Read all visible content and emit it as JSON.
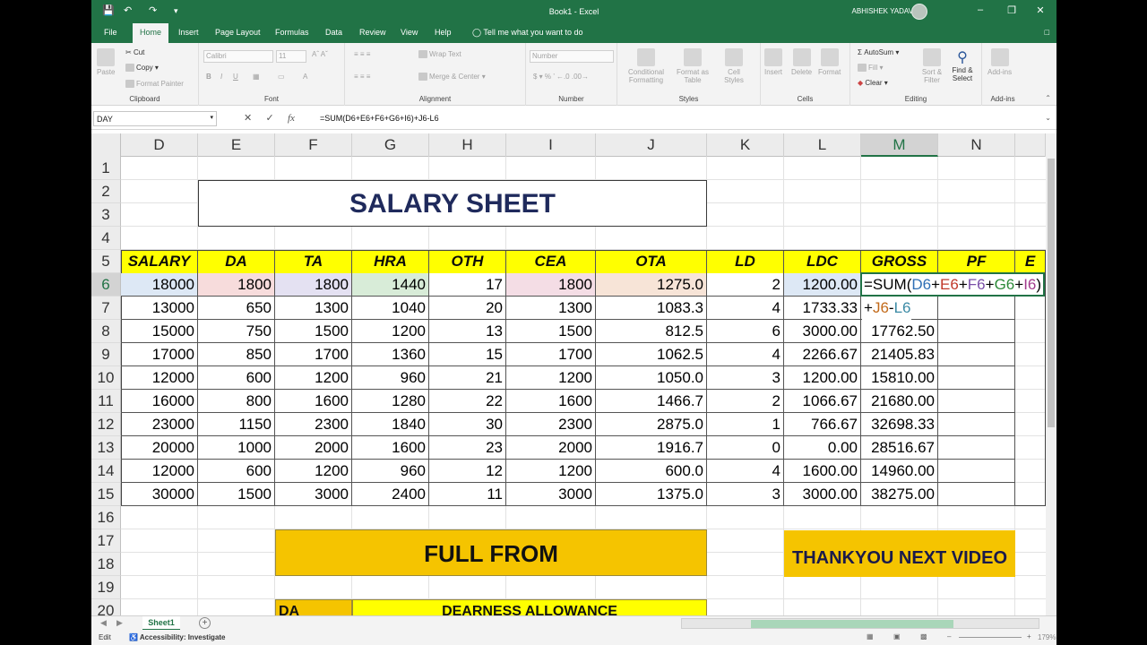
{
  "window": {
    "title": "Book1 - Excel",
    "user": "ABHISHEK YADAV"
  },
  "quick_access": {
    "save_icon": "save-icon",
    "undo_icon": "undo-icon",
    "redo_icon": "redo-icon"
  },
  "tabs": [
    "File",
    "Home",
    "Insert",
    "Page Layout",
    "Formulas",
    "Data",
    "Review",
    "View",
    "Help"
  ],
  "active_tab": "Home",
  "tell_me": "Tell me what you want to do",
  "ribbon": {
    "clipboard": {
      "label": "Clipboard",
      "paste": "Paste",
      "cut": "Cut",
      "copy": "Copy",
      "format_painter": "Format Painter"
    },
    "font": {
      "label": "Font",
      "name": "Calibri",
      "size": "11"
    },
    "alignment": {
      "label": "Alignment",
      "wrap": "Wrap Text",
      "merge": "Merge & Center"
    },
    "number": {
      "label": "Number",
      "format": "Number"
    },
    "styles": {
      "label": "Styles",
      "conditional": "Conditional Formatting",
      "format_table": "Format as Table",
      "cell_styles": "Cell Styles"
    },
    "cells": {
      "label": "Cells",
      "insert": "Insert",
      "delete": "Delete",
      "format": "Format"
    },
    "editing": {
      "label": "Editing",
      "autosum": "AutoSum",
      "fill": "Fill",
      "clear": "Clear",
      "sort": "Sort & Filter",
      "find": "Find & Select"
    },
    "addins": {
      "label": "Add-ins",
      "addins": "Add-ins"
    }
  },
  "formula_bar": {
    "name_box": "DAY",
    "formula": "=SUM(D6+E6+F6+G6+I6)+J6-L6",
    "fx": "fx"
  },
  "columns": [
    "D",
    "E",
    "F",
    "G",
    "H",
    "I",
    "J",
    "K",
    "L",
    "M",
    "N"
  ],
  "rows": [
    "1",
    "2",
    "3",
    "4",
    "5",
    "6",
    "7",
    "8",
    "9",
    "10",
    "11",
    "12",
    "13",
    "14",
    "15",
    "16",
    "17",
    "18",
    "19",
    "20"
  ],
  "title": "SALARY SHEET",
  "headers": [
    "SALARY",
    "DA",
    "TA",
    "HRA",
    "OTH",
    "CEA",
    "OTA",
    "LD",
    "LDC",
    "GROSS",
    "PF",
    "E"
  ],
  "table": [
    [
      "18000",
      "1800",
      "1800",
      "1440",
      "17",
      "1800",
      "1275.0",
      "2",
      "1200.00"
    ],
    [
      "13000",
      "650",
      "1300",
      "1040",
      "20",
      "1300",
      "1083.3",
      "4",
      "1733.33"
    ],
    [
      "15000",
      "750",
      "1500",
      "1200",
      "13",
      "1500",
      "812.5",
      "6",
      "3000.00"
    ],
    [
      "17000",
      "850",
      "1700",
      "1360",
      "15",
      "1700",
      "1062.5",
      "4",
      "2266.67"
    ],
    [
      "12000",
      "600",
      "1200",
      "960",
      "21",
      "1200",
      "1050.0",
      "3",
      "1200.00"
    ],
    [
      "16000",
      "800",
      "1600",
      "1280",
      "22",
      "1600",
      "1466.7",
      "2",
      "1066.67"
    ],
    [
      "23000",
      "1150",
      "2300",
      "1840",
      "30",
      "2300",
      "2875.0",
      "1",
      "766.67"
    ],
    [
      "20000",
      "1000",
      "2000",
      "1600",
      "23",
      "2000",
      "1916.7",
      "0",
      "0.00"
    ],
    [
      "12000",
      "600",
      "1200",
      "960",
      "12",
      "1200",
      "600.0",
      "4",
      "1600.00"
    ],
    [
      "30000",
      "1500",
      "3000",
      "2400",
      "11",
      "3000",
      "1375.0",
      "3",
      "3000.00"
    ]
  ],
  "gross": [
    "",
    "",
    "17762.50",
    "21405.83",
    "15810.00",
    "21680.00",
    "32698.33",
    "28516.67",
    "14960.00",
    "38275.00"
  ],
  "edit_formula": {
    "line1": [
      "=SUM(",
      "D6",
      "+",
      "E6",
      "+",
      "F6",
      "+",
      "G6",
      "+",
      "I6",
      ")"
    ],
    "line2": [
      "+",
      "J6",
      "-",
      "L6"
    ]
  },
  "full_from": "FULL FROM",
  "thankyou": "THANKYOU NEXT VIDEO",
  "row20": {
    "da": "DA",
    "desc": "DEARNESS ALLOWANCE"
  },
  "sheet_tab": "Sheet1",
  "status": {
    "mode": "Edit",
    "accessibility": "Accessibility: Investigate",
    "zoom": "179%"
  },
  "colors": {
    "excel_green": "#217346",
    "yellow": "#ffff00",
    "orange": "#f5c400",
    "title": "#1f2a5c"
  }
}
